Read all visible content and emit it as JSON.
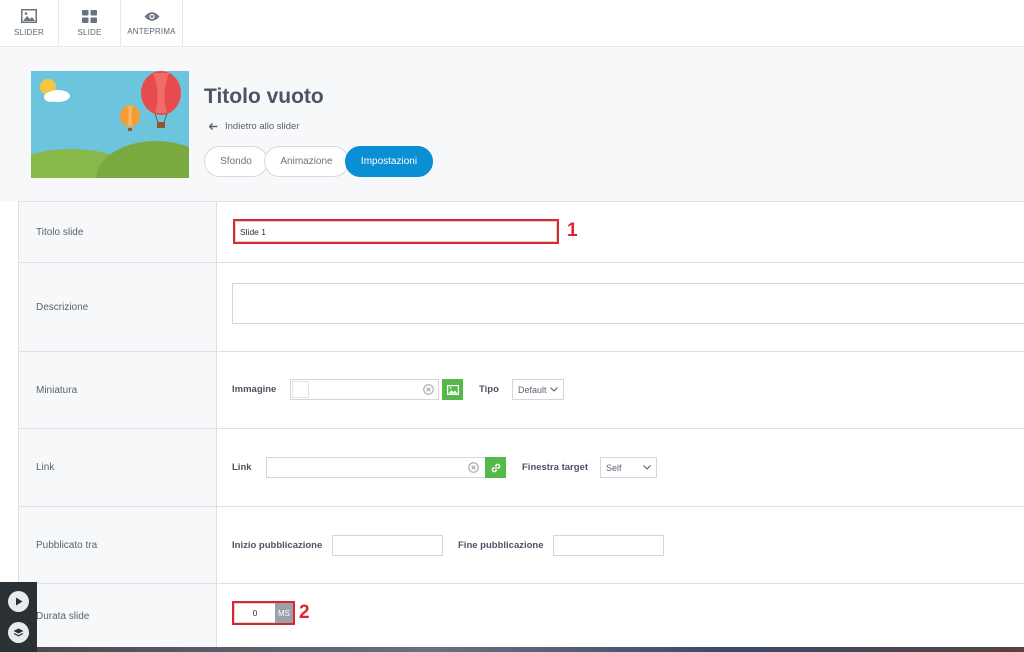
{
  "toolbar": {
    "items": [
      {
        "label": "SLIDER",
        "icon": "image-icon"
      },
      {
        "label": "SLIDE",
        "icon": "grid-icon"
      },
      {
        "label": "ANTEPRIMA",
        "icon": "eye-icon"
      }
    ]
  },
  "header": {
    "title": "Titolo vuoto",
    "back_label": "Indietro allo slider",
    "tabs": [
      {
        "label": "Sfondo",
        "active": false
      },
      {
        "label": "Animazione",
        "active": false
      },
      {
        "label": "Impostazioni",
        "active": true
      }
    ]
  },
  "form": {
    "titolo_slide": {
      "label": "Titolo slide",
      "value": "Slide 1",
      "annotation": "1"
    },
    "descrizione": {
      "label": "Descrizione",
      "value": ""
    },
    "miniatura": {
      "label": "Miniatura",
      "image_label": "Immagine",
      "image_value": "",
      "tipo_label": "Tipo",
      "tipo_value": "Default"
    },
    "link": {
      "label": "Link",
      "link_label": "Link",
      "link_value": "",
      "target_label": "Finestra target",
      "target_value": "Self"
    },
    "pubblicato": {
      "label": "Pubblicato tra",
      "start_label": "Inizio pubblicazione",
      "start_value": "",
      "end_label": "Fine pubblicazione",
      "end_value": ""
    },
    "durata": {
      "label": "Durata slide",
      "value": "0",
      "unit": "MS",
      "annotation": "2"
    }
  },
  "colors": {
    "accent": "#0a8fd4",
    "green": "#53b948",
    "annotation_red": "#e0242c"
  }
}
